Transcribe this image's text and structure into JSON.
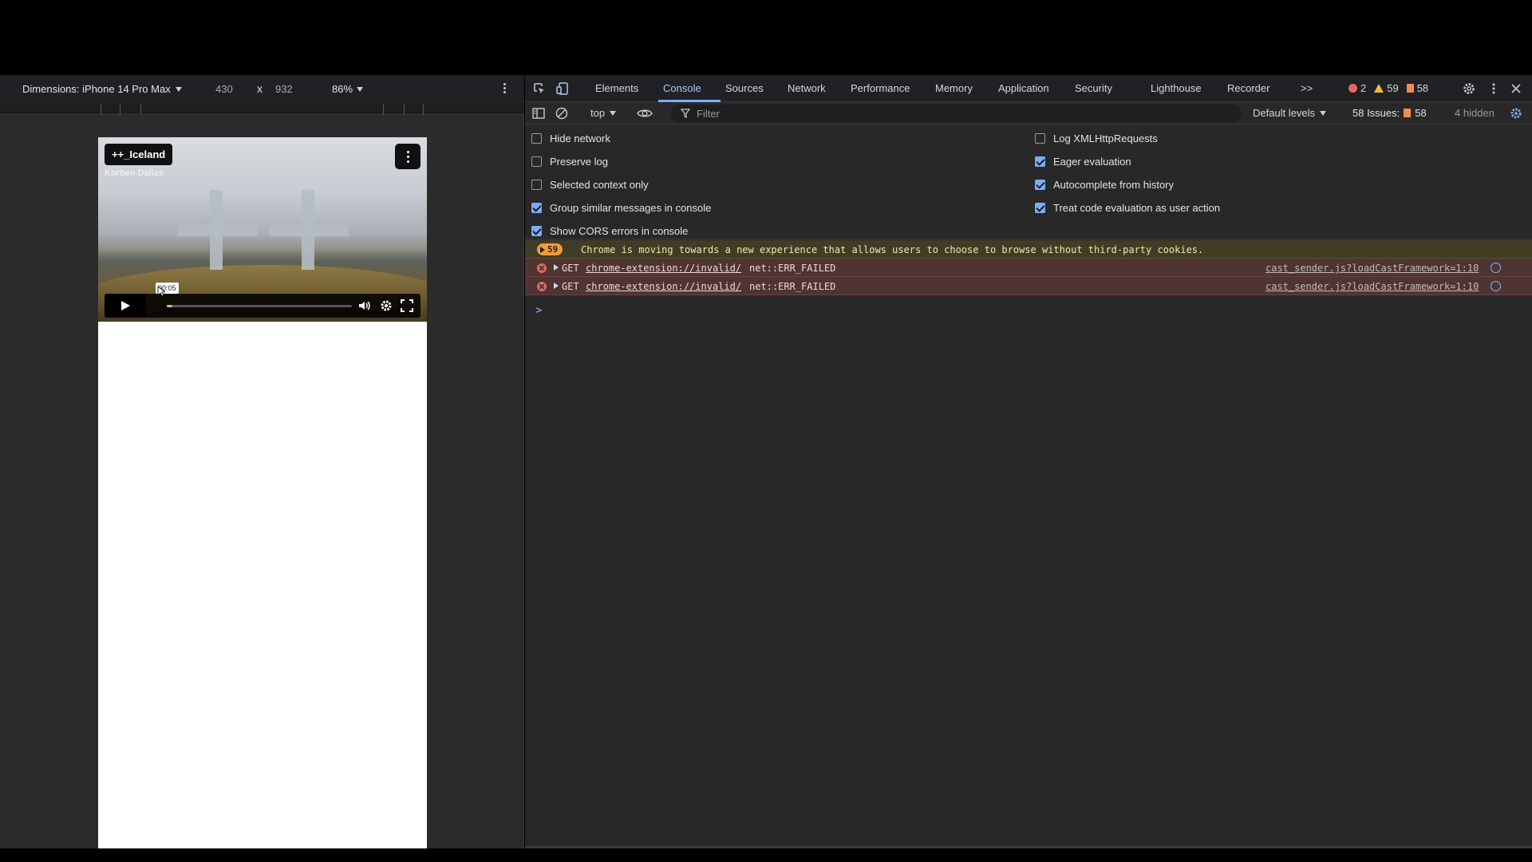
{
  "device_toolbar": {
    "dimensions_label": "Dimensions: iPhone 14 Pro Max",
    "width": "430",
    "times": "x",
    "height": "932",
    "zoom": "86%"
  },
  "video": {
    "channel": "++_Iceland",
    "channel_sub": "Korben Dallas",
    "time_tooltip": "00:05",
    "progress_fraction": 0.03
  },
  "devtools": {
    "tabs": [
      "Elements",
      "Console",
      "Sources",
      "Network",
      "Performance",
      "Memory",
      "Application",
      "Security",
      "Lighthouse",
      "Recorder"
    ],
    "active_tab": "Console",
    "overflow": ">>",
    "counters": {
      "errors": "2",
      "warnings": "59",
      "issues": "58"
    },
    "toolbar": {
      "context": "top",
      "filter_placeholder": "Filter",
      "levels": "Default levels",
      "issues_label": "58 Issues:",
      "issues_count": "58",
      "hidden": "4 hidden"
    },
    "settings": {
      "left": [
        {
          "label": "Hide network",
          "checked": false
        },
        {
          "label": "Preserve log",
          "checked": false
        },
        {
          "label": "Selected context only",
          "checked": false
        },
        {
          "label": "Group similar messages in console",
          "checked": true
        },
        {
          "label": "Show CORS errors in console",
          "checked": true
        }
      ],
      "right": [
        {
          "label": "Log XMLHttpRequests",
          "checked": false
        },
        {
          "label": "Eager evaluation",
          "checked": true
        },
        {
          "label": "Autocomplete from history",
          "checked": true
        },
        {
          "label": "Treat code evaluation as user action",
          "checked": true
        }
      ]
    },
    "messages": {
      "warning": {
        "count": "59",
        "text": "Chrome is moving towards a new experience that allows users to choose to browse without third-party cookies."
      },
      "errors": [
        {
          "method": "GET",
          "url": "chrome-extension://invalid/",
          "status": "net::ERR_FAILED",
          "source": "cast_sender.js?loadCastFramework=1:10"
        },
        {
          "method": "GET",
          "url": "chrome-extension://invalid/",
          "status": "net::ERR_FAILED",
          "source": "cast_sender.js?loadCastFramework=1:10"
        }
      ],
      "prompt": ">"
    }
  },
  "colors": {
    "accent_blue": "#7cacf8",
    "error_red": "#e46962",
    "warning_yellow": "#f2b83c",
    "issue_orange": "#f28b54"
  }
}
